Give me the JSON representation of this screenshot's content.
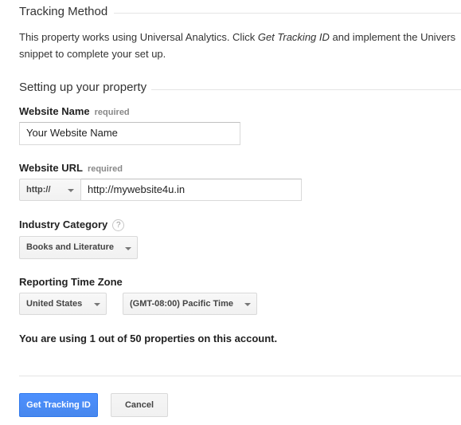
{
  "tracking_method": {
    "title": "Tracking Method",
    "desc_prefix": "This property works using Universal Analytics. Click ",
    "desc_link": "Get Tracking ID",
    "desc_suffix": " and implement the Univers",
    "desc_line2": "snippet to complete your set up."
  },
  "setup": {
    "title": "Setting up your property",
    "website_name": {
      "label": "Website Name",
      "required": "required",
      "value": "Your Website Name"
    },
    "website_url": {
      "label": "Website URL",
      "required": "required",
      "protocol": "http://",
      "value": "http://mywebsite4u.in"
    },
    "industry_category": {
      "label": "Industry Category",
      "help": "?",
      "value": "Books and Literature"
    },
    "reporting_time_zone": {
      "label": "Reporting Time Zone",
      "country": "United States",
      "zone": "(GMT-08:00) Pacific Time"
    },
    "usage_note": "You are using 1 out of 50 properties on this account."
  },
  "actions": {
    "get_tracking_id": "Get Tracking ID",
    "cancel": "Cancel"
  },
  "icons": {
    "dropdown_caret": "chevron-down-icon",
    "help": "help-icon"
  },
  "colors": {
    "primary_button": "#4d90fe",
    "divider": "#e5e5e5",
    "required_text": "#888888"
  }
}
